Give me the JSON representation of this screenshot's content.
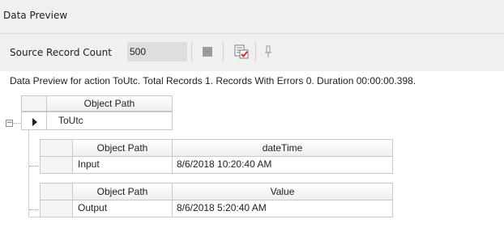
{
  "panel": {
    "title": "Data Preview"
  },
  "toolbar": {
    "source_record_count_label": "Source Record Count",
    "source_record_count_value": "500",
    "stop_icon": "stop-icon",
    "preview_icon": "preview-checklist-icon",
    "pin_icon": "pin-icon"
  },
  "status_text": "Data Preview for action ToUtc. Total Records 1. Records With Errors 0. Duration 00:00:00.398.",
  "outer_grid": {
    "column_header": "Object Path",
    "row_value": "ToUtc"
  },
  "input_grid": {
    "headers": [
      "Object Path",
      "dateTime"
    ],
    "row": [
      "Input",
      "8/6/2018 10:20:40 AM"
    ]
  },
  "output_grid": {
    "headers": [
      "Object Path",
      "Value"
    ],
    "row": [
      "Output",
      "8/6/2018 5:20:40 AM"
    ]
  },
  "expander_symbol": "−",
  "colors": {
    "title_bg": "#f0f0f0",
    "toolbar_bg": "#f0f0f0",
    "input_bg": "#dedede",
    "stop_gray": "#9a9a9a",
    "check_red": "#d9262c"
  }
}
